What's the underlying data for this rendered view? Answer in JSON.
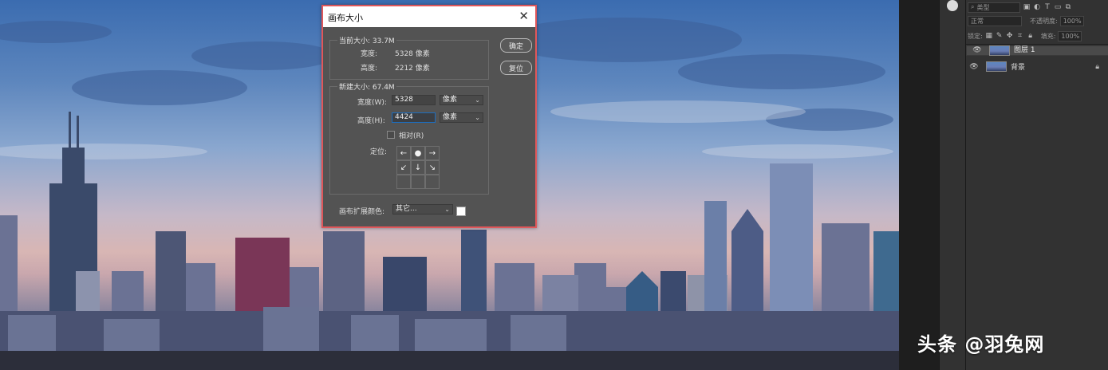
{
  "dialog": {
    "title": "画布大小",
    "current_size_label": "当前大小: 33.7M",
    "current_width_label": "宽度:",
    "current_width_value": "5328 像素",
    "current_height_label": "高度:",
    "current_height_value": "2212 像素",
    "new_size_label": "新建大小: 67.4M",
    "width_label": "宽度(W):",
    "width_value": "5328",
    "width_unit": "像素",
    "height_label": "高度(H):",
    "height_value": "4424",
    "height_unit": "像素",
    "relative_label": "相对(R)",
    "relative_checked": false,
    "anchor_label": "定位:",
    "anchor_cells": [
      "←",
      "●",
      "→",
      "↙",
      "↓",
      "↘",
      "",
      "",
      ""
    ],
    "ok_label": "确定",
    "reset_label": "复位",
    "extension_color_label": "画布扩展颜色:",
    "extension_color_value": "其它...",
    "extension_color": "#ffffff",
    "close_icon": "close-icon"
  },
  "layers_panel": {
    "filter_placeholder": "类型",
    "blend_mode": "正常",
    "opacity_label": "不透明度:",
    "opacity_value": "100%",
    "lock_label": "锁定:",
    "fill_label": "填充:",
    "fill_value": "100%",
    "layers": [
      {
        "name": "图层 1",
        "visible": true,
        "selected": true,
        "locked": false
      },
      {
        "name": "背景",
        "visible": true,
        "selected": false,
        "locked": true
      }
    ]
  },
  "watermark": "头条 @羽兔网",
  "colors": {
    "dialog_bg": "#535353",
    "dialog_border": "#e0575a",
    "panel_bg": "#323232",
    "focus_blue": "#1c6dbe"
  }
}
